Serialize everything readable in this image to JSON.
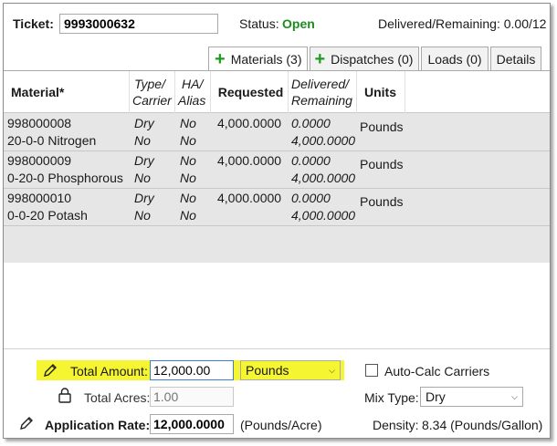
{
  "header": {
    "ticket_label": "Ticket:",
    "ticket_value": "9993000632",
    "status_label": "Status:",
    "status_value": "Open",
    "delivered_remaining": "Delivered/Remaining: 0.00/12"
  },
  "tabs": [
    {
      "label": "Materials (3)",
      "plus": "+",
      "active": true
    },
    {
      "label": "Dispatches (0)",
      "plus": "+"
    },
    {
      "label": "Loads (0)"
    },
    {
      "label": "Details"
    }
  ],
  "grid": {
    "columns": {
      "material": "Material*",
      "type_carrier": [
        "Type/",
        "Carrier"
      ],
      "ha_alias": [
        "HA/",
        "Alias"
      ],
      "requested": "Requested",
      "delivered_remaining": [
        "Delivered/",
        "Remaining"
      ],
      "units": "Units"
    },
    "rows": [
      {
        "code": "998000008",
        "name": "20-0-0 Nitrogen",
        "type": "Dry",
        "carrier": "No",
        "ha": "No",
        "alias": "No",
        "requested": "4,000.0000",
        "delivered": "0.0000",
        "remaining": "4,000.0000",
        "units": "Pounds"
      },
      {
        "code": "998000009",
        "name": "0-20-0 Phosphorous",
        "type": "Dry",
        "carrier": "No",
        "ha": "No",
        "alias": "No",
        "requested": "4,000.0000",
        "delivered": "0.0000",
        "remaining": "4,000.0000",
        "units": "Pounds"
      },
      {
        "code": "998000010",
        "name": "0-0-20 Potash",
        "type": "Dry",
        "carrier": "No",
        "ha": "No",
        "alias": "No",
        "requested": "4,000.0000",
        "delivered": "0.0000",
        "remaining": "4,000.0000",
        "units": "Pounds"
      }
    ]
  },
  "bottom": {
    "total_amount_label": "Total Amount:",
    "total_amount_value": "12,000.00",
    "units_selected": "Pounds",
    "auto_calc_label": "Auto-Calc Carriers",
    "total_acres_label": "Total Acres:",
    "total_acres_placeholder": "1.00",
    "mix_type_label": "Mix Type:",
    "mix_type_selected": "Dry",
    "application_rate_label": "Application Rate:",
    "application_rate_value": "12,000.0000",
    "application_rate_units": "(Pounds/Acre)",
    "density_label": "Density:",
    "density_value": "8.34 (Pounds/Gallon)"
  },
  "colors": {
    "status_open": "#1e8b1e",
    "plus_icon": "#1e9a1e",
    "highlight": "#f5f532"
  },
  "icons": [
    "pencil-icon",
    "lock-icon",
    "plus-icon",
    "chevron-down-icon"
  ]
}
